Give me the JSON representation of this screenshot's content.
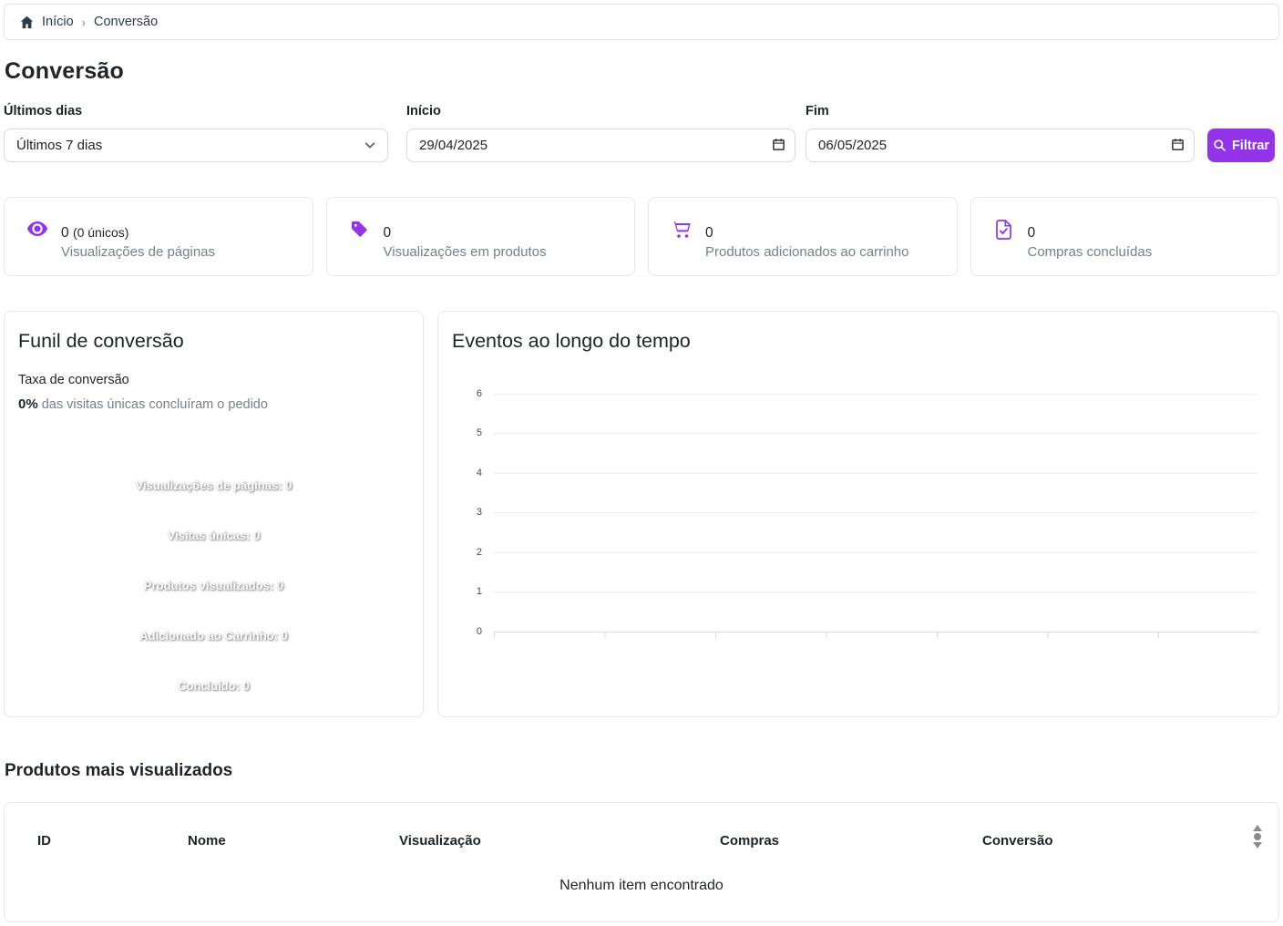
{
  "colors": {
    "accent": "#9333ea",
    "text_muted": "#75808a",
    "breadcrumb_text": "#2d3b48"
  },
  "breadcrumb": {
    "home_label": "Início",
    "current": "Conversão"
  },
  "page": {
    "title": "Conversão"
  },
  "filters": {
    "period_label": "Últimos dias",
    "period_value": "Últimos 7 dias",
    "start_label": "Início",
    "start_value": "29/04/2025",
    "end_label": "Fim",
    "end_value": "06/05/2025",
    "filter_button": "Filtrar"
  },
  "stats": [
    {
      "icon": "eye-icon",
      "value": "0",
      "value_extra": "(0 únicos)",
      "label": "Visualizações de páginas"
    },
    {
      "icon": "tag-icon",
      "value": "0",
      "value_extra": "",
      "label": "Visualizações em produtos"
    },
    {
      "icon": "cart-icon",
      "value": "0",
      "value_extra": "",
      "label": "Produtos adicionados ao carrinho"
    },
    {
      "icon": "doc-check-icon",
      "value": "0",
      "value_extra": "",
      "label": "Compras concluídas"
    }
  ],
  "funnel": {
    "title": "Funil de conversão",
    "rate_label": "Taxa de conversão",
    "rate_value": "0%",
    "rate_text": "das visitas únicas concluíram o pedido",
    "stages": [
      "Visualizações de páginas: 0",
      "Visitas únicas: 0",
      "Produtos visualizados: 0",
      "Adicionado ao Carrinho: 0",
      "Concluído: 0"
    ]
  },
  "chart_data": {
    "type": "line",
    "title": "Eventos ao longo do tempo",
    "x": [],
    "series": [],
    "yticks": [
      0,
      1,
      2,
      3,
      4,
      5,
      6
    ],
    "ylim": [
      0,
      6
    ],
    "xlabel": "",
    "ylabel": "",
    "grid": true,
    "legend": false
  },
  "table": {
    "title": "Produtos mais visualizados",
    "headers": [
      "ID",
      "Nome",
      "Visualização",
      "Compras",
      "Conversão"
    ],
    "rows": [],
    "empty_text": "Nenhum item encontrado"
  }
}
